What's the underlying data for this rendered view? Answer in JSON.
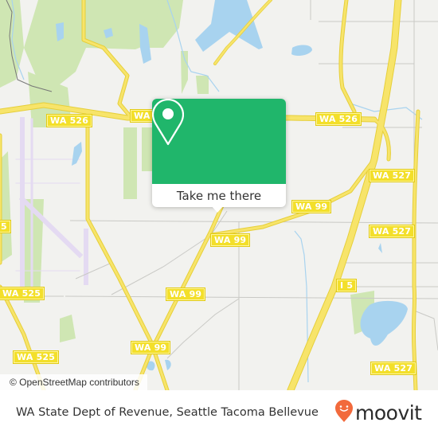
{
  "map": {
    "colors": {
      "background": "#f2f2ef",
      "water": "#a8d3ef",
      "park": "#cfe6b3",
      "road": "#f7e46a",
      "road_outline": "#e6cf3a",
      "minor_road": "#c9c9c5",
      "runway": "#e4daf2",
      "popup_green": "#20b66b"
    },
    "road_shields": [
      {
        "id": "wa526-left",
        "label": "WA 526"
      },
      {
        "id": "wa526-top-mid",
        "label": "WA"
      },
      {
        "id": "wa526-right",
        "label": "WA 526"
      },
      {
        "id": "wa527-upper",
        "label": "WA 527"
      },
      {
        "id": "wa99-east",
        "label": "WA 99"
      },
      {
        "id": "wa527-mid",
        "label": "WA 527"
      },
      {
        "id": "wa99-center",
        "label": "WA 99"
      },
      {
        "id": "i5",
        "label": "I 5"
      },
      {
        "id": "wa99-south",
        "label": "WA 99"
      },
      {
        "id": "wa99-southwest",
        "label": "WA 99"
      },
      {
        "id": "wa525-upper",
        "label": "WA 525"
      },
      {
        "id": "wa525-lower",
        "label": "WA 525"
      },
      {
        "id": "wa525-edge",
        "label": "5"
      },
      {
        "id": "wa527-lower",
        "label": "WA 527"
      }
    ],
    "attribution": "© OpenStreetMap contributors"
  },
  "popup": {
    "icon": "map-pin-icon",
    "button_label": "Take me there"
  },
  "footer": {
    "title": "WA State Dept of Revenue, Seattle Tacoma Bellevue",
    "brand": "moovit",
    "brand_icon": "moovit-logo-icon",
    "brand_color": "#f26a3c"
  }
}
